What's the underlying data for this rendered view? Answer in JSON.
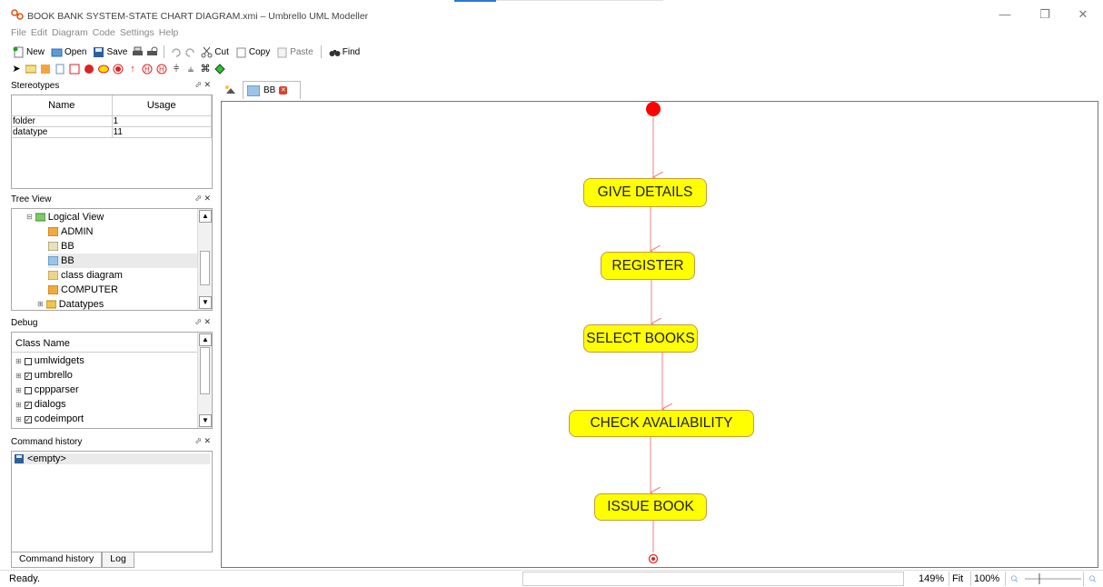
{
  "window": {
    "title": "BOOK BANK SYSTEM-STATE CHART DIAGRAM.xmi – Umbrello UML Modeller",
    "minimize_glyph": "—",
    "restore_glyph": "❐",
    "close_glyph": "✕"
  },
  "menu": [
    "File",
    "Edit",
    "Diagram",
    "Code",
    "Settings",
    "Help"
  ],
  "toolbar": {
    "new_label": "New",
    "open_label": "Open",
    "save_label": "Save",
    "cut_label": "Cut",
    "copy_label": "Copy",
    "paste_label": "Paste",
    "find_label": "Find"
  },
  "stereotypes": {
    "title": "Stereotypes",
    "columns": [
      "Name",
      "Usage"
    ],
    "rows": [
      {
        "name": "folder",
        "usage": "1"
      },
      {
        "name": "datatype",
        "usage": "11"
      }
    ]
  },
  "tree_view": {
    "title": "Tree View",
    "items": [
      {
        "label": "Logical View",
        "icon": "folder-open-icon"
      },
      {
        "label": "ADMIN",
        "icon": "class-icon"
      },
      {
        "label": "BB",
        "icon": "diagram-icon"
      },
      {
        "label": "BB",
        "icon": "state-diagram-icon"
      },
      {
        "label": "class diagram",
        "icon": "diagram-icon"
      },
      {
        "label": "COMPUTER",
        "icon": "class-icon"
      },
      {
        "label": "Datatypes",
        "icon": "folder-icon"
      }
    ]
  },
  "debug": {
    "title": "Debug",
    "column": "Class Name",
    "items": [
      {
        "label": "umlwidgets",
        "checked": false
      },
      {
        "label": "umbrello",
        "checked": true
      },
      {
        "label": "cppparser",
        "checked": false
      },
      {
        "label": "dialogs",
        "checked": true
      },
      {
        "label": "codeimport",
        "checked": true
      }
    ]
  },
  "command_history": {
    "title": "Command history",
    "items": [
      "<empty>"
    ],
    "tabs": [
      "Command history",
      "Log"
    ]
  },
  "diagram": {
    "tab_label": "BB",
    "states": [
      "GIVE DETAILS",
      "REGISTER",
      "SELECT BOOKS",
      "CHECK AVALIABILITY",
      "ISSUE BOOK"
    ],
    "colors": {
      "state_fill": "#ffff00",
      "state_border": "#c59a3e",
      "transition": "#f08080",
      "initial": "#ff0000"
    }
  },
  "status": {
    "text": "Ready.",
    "zoom": "149%",
    "fit_label": "Fit",
    "hundred_label": "100%"
  }
}
